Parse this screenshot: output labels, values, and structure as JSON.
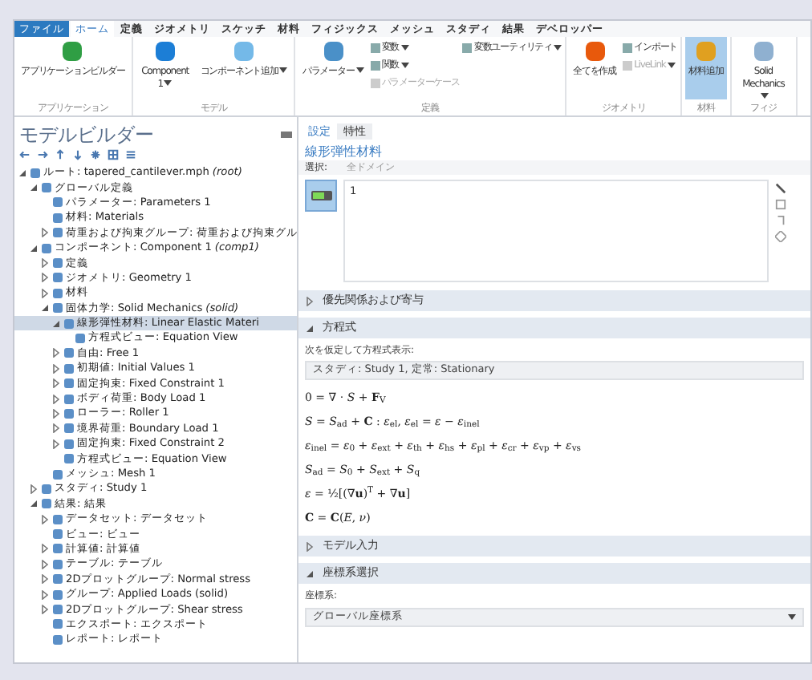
{
  "ribbon_tabs": [
    {
      "label": "ファイル",
      "kind": "file",
      "selected": false
    },
    {
      "label": "ホーム",
      "kind": "tab",
      "selected": true
    },
    {
      "label": "定義",
      "kind": "tab",
      "selected": false
    },
    {
      "label": "ジオメトリ",
      "kind": "tab",
      "selected": false
    },
    {
      "label": "スケッチ",
      "kind": "tab",
      "selected": false
    },
    {
      "label": "材料",
      "kind": "tab",
      "selected": false
    },
    {
      "label": "フィジックス",
      "kind": "tab",
      "selected": false
    },
    {
      "label": "メッシュ",
      "kind": "tab",
      "selected": false
    },
    {
      "label": "スタディ",
      "kind": "tab",
      "selected": false
    },
    {
      "label": "結果",
      "kind": "tab",
      "selected": false
    },
    {
      "label": "デベロッパー",
      "kind": "tab",
      "selected": false
    }
  ],
  "ribbon_groups": [
    {
      "label": "アプリケーション",
      "items": [
        {
          "label": "アプリケーションビルダー",
          "kind": "large",
          "dropdown": false,
          "disabled": false,
          "selected": false
        }
      ]
    },
    {
      "label": "モデル",
      "items": [
        {
          "label": "Component 1",
          "kind": "large",
          "dropdown": true,
          "disabled": false,
          "selected": false
        },
        {
          "label": "コンポーネント追加",
          "kind": "large",
          "dropdown": true,
          "disabled": false,
          "selected": false
        }
      ]
    },
    {
      "label": "定義",
      "items": [
        {
          "label": "パラメーター",
          "kind": "large",
          "dropdown": true,
          "disabled": false,
          "selected": false
        },
        {
          "label": "変数",
          "kind": "small",
          "dropdown": true,
          "disabled": false,
          "selected": false
        },
        {
          "label": "関数",
          "kind": "small",
          "dropdown": true,
          "disabled": false,
          "selected": false
        },
        {
          "label": "パラメーターケース",
          "kind": "small",
          "dropdown": false,
          "disabled": true,
          "selected": false
        },
        {
          "label": "変数ユーティリティ",
          "kind": "small",
          "dropdown": true,
          "disabled": false,
          "selected": false
        }
      ]
    },
    {
      "label": "ジオメトリ",
      "items": [
        {
          "label": "全てを作成",
          "kind": "large",
          "dropdown": false,
          "disabled": false,
          "selected": false
        },
        {
          "label": "インポート",
          "kind": "small",
          "dropdown": false,
          "disabled": false,
          "selected": false
        },
        {
          "label": "LiveLink",
          "kind": "small",
          "dropdown": true,
          "disabled": true,
          "selected": false
        }
      ]
    },
    {
      "label": "材料",
      "items": [
        {
          "label": "材料追加",
          "kind": "large",
          "dropdown": false,
          "disabled": false,
          "selected": true
        }
      ]
    },
    {
      "label": "フィジ",
      "items": [
        {
          "label": "Solid Mechanics",
          "kind": "large",
          "dropdown": true,
          "disabled": false,
          "selected": false
        }
      ]
    }
  ],
  "model_builder": {
    "title": "モデルビルダー",
    "tree": [
      {
        "label": "ルート: tapered_cantilever.mph",
        "tag": "(root)",
        "expanded": true,
        "selected": false,
        "children": [
          {
            "label": "グローバル定義",
            "expanded": true,
            "selected": false,
            "children": [
              {
                "label": "パラメーター: Parameters 1",
                "selected": false
              },
              {
                "label": "材料: Materials",
                "selected": false
              },
              {
                "label": "荷重および拘束グループ: 荷重および拘束グル",
                "expanded": false,
                "selected": false
              }
            ]
          },
          {
            "label": "コンポーネント: Component 1",
            "tag": "(comp1)",
            "expanded": true,
            "selected": false,
            "children": [
              {
                "label": "定義",
                "expanded": false,
                "selected": false
              },
              {
                "label": "ジオメトリ: Geometry 1",
                "expanded": false,
                "selected": false
              },
              {
                "label": "材料",
                "expanded": false,
                "selected": false
              },
              {
                "label": "固体力学: Solid Mechanics",
                "tag": "(solid)",
                "expanded": true,
                "selected": false,
                "children": [
                  {
                    "label": "線形弾性材料: Linear Elastic Materi",
                    "expanded": true,
                    "selected": true,
                    "children": [
                      {
                        "label": "方程式ビュー: Equation View",
                        "selected": false
                      }
                    ]
                  },
                  {
                    "label": "自由: Free 1",
                    "expanded": false,
                    "selected": false
                  },
                  {
                    "label": "初期値: Initial Values 1",
                    "expanded": false,
                    "selected": false
                  },
                  {
                    "label": "固定拘束: Fixed Constraint 1",
                    "expanded": false,
                    "selected": false
                  },
                  {
                    "label": "ボディ荷重: Body Load 1",
                    "expanded": false,
                    "selected": false
                  },
                  {
                    "label": "ローラー: Roller 1",
                    "expanded": false,
                    "selected": false
                  },
                  {
                    "label": "境界荷重: Boundary Load 1",
                    "expanded": false,
                    "selected": false
                  },
                  {
                    "label": "固定拘束: Fixed Constraint 2",
                    "expanded": false,
                    "selected": false
                  },
                  {
                    "label": "方程式ビュー: Equation View",
                    "selected": false
                  }
                ]
              },
              {
                "label": "メッシュ: Mesh 1",
                "selected": false
              }
            ]
          },
          {
            "label": "スタディ: Study 1",
            "expanded": false,
            "selected": false
          },
          {
            "label": "結果: 結果",
            "expanded": true,
            "selected": false,
            "children": [
              {
                "label": "データセット: データセット",
                "expanded": false,
                "selected": false
              },
              {
                "label": "ビュー: ビュー",
                "selected": false
              },
              {
                "label": "計算値: 計算値",
                "expanded": false,
                "selected": false
              },
              {
                "label": "テーブル: テーブル",
                "expanded": false,
                "selected": false
              },
              {
                "label": "2Dプロットグループ: Normal stress",
                "expanded": false,
                "selected": false
              },
              {
                "label": "グループ: Applied Loads (solid)",
                "expanded": false,
                "selected": false
              },
              {
                "label": "2Dプロットグループ: Shear stress",
                "expanded": false,
                "selected": false
              },
              {
                "label": "エクスポート: エクスポート",
                "selected": false
              },
              {
                "label": "レポート: レポート",
                "selected": false
              }
            ]
          }
        ]
      }
    ]
  },
  "settings": {
    "tabs": [
      {
        "label": "設定",
        "selected": true
      },
      {
        "label": "特性",
        "selected": false
      }
    ],
    "title": "線形弾性材料",
    "selection_label": "選択:",
    "selection_value": "全ドメイン",
    "selection_list": [
      "1"
    ],
    "sections": [
      {
        "label": "優先関係および寄与",
        "expanded": false
      },
      {
        "label": "方程式",
        "expanded": true,
        "assume_label": "次を仮定して方程式表示:",
        "study": "スタディ: Study 1, 定常: Stationary",
        "equations": [
          "0 = ∇ · *S* + **F**$_{V}$",
          "*S* = *S*$_{ad}$ + **C** : *ε*$_{el}$,   *ε*$_{el}$ = *ε* − *ε*$_{inel}$",
          "*ε*$_{inel}$ = *ε*$_{0}$ + *ε*$_{ext}$ + *ε*$_{th}$ + *ε*$_{hs}$ + *ε*$_{pl}$ + *ε*$_{cr}$ + *ε*$_{vp}$ + *ε*$_{vs}$",
          "*S*$_{ad}$ = *S*$_{0}$ + *S*$_{ext}$ + *S*$_{q}$",
          "*ε* = ½[(∇**u**)$^{T}$ + ∇**u**]",
          "**C** = **C**(*E*, *ν*)"
        ]
      },
      {
        "label": "モデル入力",
        "expanded": false
      },
      {
        "label": "座標系選択",
        "expanded": true,
        "field_label": "座標系:",
        "value": "グローバル座標系"
      }
    ]
  }
}
